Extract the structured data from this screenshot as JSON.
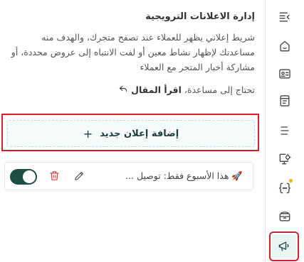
{
  "section": {
    "title": "إدارة الاعلانات الترويجية",
    "description": "شريط إعلاني يظهر للعملاء عند تصفح متجرك، والهدف منه مساعدتك لإظهار نشاط معين أو لفت الانتباه إلى عروض محددة، أو مشاركة أخبار المتجر مع العملاء",
    "help_text": "تحتاج إلى مساعدة،",
    "help_link": "اقرأ المقال"
  },
  "add_button": {
    "label": "إضافة إعلان جديد",
    "plus": "+"
  },
  "ads": [
    {
      "emoji": "🚀",
      "text": "هذا الأسبوع فقط: توصيل ...",
      "enabled": true
    }
  ],
  "rail": {
    "items": [
      "collapse-icon",
      "home-icon",
      "id-card-icon",
      "invoice-icon",
      "menu-list-icon",
      "monitor-settings-icon",
      "code-braces-icon",
      "box-icon",
      "megaphone-icon"
    ],
    "active": "megaphone-icon",
    "notification_dot_on": "code-braces-icon"
  },
  "colors": {
    "accent": "#1e4d48",
    "highlight_outline": "#d0202e",
    "add_button_bg": "#f4fbfa",
    "delete": "#d23b3b",
    "dot": "#f0b400"
  }
}
